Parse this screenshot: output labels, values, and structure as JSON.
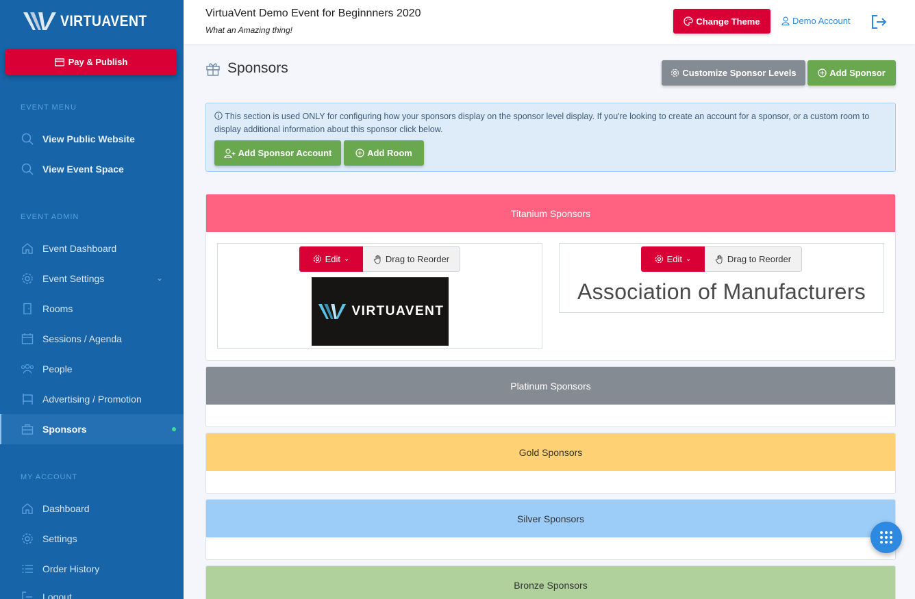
{
  "sidebar": {
    "logo_text": "VIRTUAVENT",
    "pay_button": "Pay & Publish",
    "event_menu_heading": "EVENT MENU",
    "event_menu": [
      {
        "label": "View Public Website",
        "icon": "search-icon"
      },
      {
        "label": "View Event Space",
        "icon": "search-icon"
      }
    ],
    "event_admin_heading": "EVENT ADMIN",
    "event_admin": [
      {
        "label": "Event Dashboard",
        "icon": "home-icon"
      },
      {
        "label": "Event Settings",
        "icon": "gear-icon"
      },
      {
        "label": "Rooms",
        "icon": "door-icon"
      },
      {
        "label": "Sessions / Agenda",
        "icon": "calendar-icon"
      },
      {
        "label": "People",
        "icon": "people-icon"
      },
      {
        "label": "Advertising / Promotion",
        "icon": "billboard-icon"
      },
      {
        "label": "Sponsors",
        "icon": "briefcase-icon"
      }
    ],
    "my_account_heading": "MY ACCOUNT",
    "my_account": [
      {
        "label": "Dashboard",
        "icon": "home-icon"
      },
      {
        "label": "Settings",
        "icon": "gear-icon"
      },
      {
        "label": "Order History",
        "icon": "list-icon"
      },
      {
        "label": "Logout",
        "icon": "logout-icon"
      }
    ]
  },
  "header": {
    "event_title": "VirtuaVent Demo Event for Beginnners 2020",
    "event_subtitle": "What an Amazing thing!",
    "change_theme": "Change Theme",
    "account": "Demo Account"
  },
  "main": {
    "title": "Sponsors",
    "customize_levels": "Customize Sponsor Levels",
    "add_sponsor": "Add Sponsor",
    "info_text": "This section is used ONLY for configuring how your sponsors display on the sponsor level display. If you're looking to create an account for a sponsor, or a custom room to display additional information about this sponsor click below.",
    "add_sponsor_account": "Add Sponsor Account",
    "add_room": "Add Room",
    "levels": [
      {
        "name": "Titanium Sponsors",
        "color": "#ff6181"
      },
      {
        "name": "Platinum Sponsors",
        "color": "#858b93"
      },
      {
        "name": "Gold Sponsors",
        "color": "#fed274"
      },
      {
        "name": "Silver Sponsors",
        "color": "#9ccdf8"
      },
      {
        "name": "Bronze Sponsors",
        "color": "#b0d09c"
      }
    ],
    "edit_label": "Edit",
    "drag_label": "Drag to Reorder",
    "sponsor_logo_text": "VIRTUAVENT",
    "sponsor_name": "Association of Manufacturers"
  },
  "colors": {
    "sidebar": "#1764a8",
    "accent_red": "#d90036",
    "green": "#6aa84f",
    "link_blue": "#2d8ae0"
  }
}
